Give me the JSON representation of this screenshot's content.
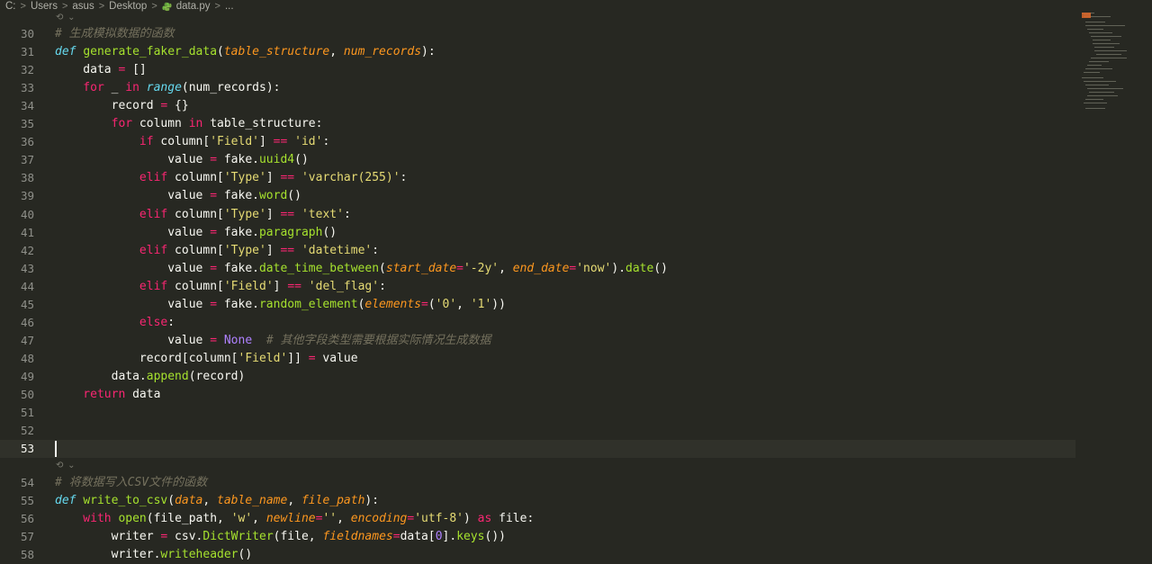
{
  "breadcrumb": {
    "items": [
      "C:",
      "Users",
      "asus",
      "Desktop",
      "data.py",
      "..."
    ],
    "separator": ">"
  },
  "fold_hint": "⟲ ⌄",
  "colors": {
    "background": "#272822",
    "keyword": "#f92672",
    "function": "#a6e22e",
    "string": "#e6db74",
    "parameter": "#fd971f",
    "comment": "#75715e",
    "builtin_def": "#66d9ef"
  },
  "editor": {
    "current_line": 53,
    "lines": [
      {
        "n": "30",
        "segs": [
          [
            "cm",
            "# 生成模拟数据的函数"
          ]
        ]
      },
      {
        "n": "31",
        "segs": [
          [
            "def",
            "def "
          ],
          [
            "fn",
            "generate_faker_data"
          ],
          [
            "pun",
            "("
          ],
          [
            "param",
            "table_structure"
          ],
          [
            "pun",
            ", "
          ],
          [
            "param",
            "num_records"
          ],
          [
            "pun",
            "):"
          ]
        ]
      },
      {
        "n": "32",
        "segs": [
          [
            "pun",
            "    data "
          ],
          [
            "op",
            "="
          ],
          [
            "pun",
            " []"
          ]
        ]
      },
      {
        "n": "33",
        "segs": [
          [
            "kw",
            "    for"
          ],
          [
            "pun",
            " _ "
          ],
          [
            "kw",
            "in"
          ],
          [
            "pun",
            " "
          ],
          [
            "def",
            "range"
          ],
          [
            "pun",
            "(num_records):"
          ]
        ]
      },
      {
        "n": "34",
        "segs": [
          [
            "pun",
            "        record "
          ],
          [
            "op",
            "="
          ],
          [
            "pun",
            " {}"
          ]
        ]
      },
      {
        "n": "35",
        "segs": [
          [
            "kw",
            "        for"
          ],
          [
            "pun",
            " column "
          ],
          [
            "kw",
            "in"
          ],
          [
            "pun",
            " table_structure:"
          ]
        ]
      },
      {
        "n": "36",
        "segs": [
          [
            "kw",
            "            if"
          ],
          [
            "pun",
            " column["
          ],
          [
            "str",
            "'Field'"
          ],
          [
            "pun",
            "] "
          ],
          [
            "op",
            "=="
          ],
          [
            "pun",
            " "
          ],
          [
            "str",
            "'id'"
          ],
          [
            "pun",
            ":"
          ]
        ]
      },
      {
        "n": "37",
        "segs": [
          [
            "pun",
            "                value "
          ],
          [
            "op",
            "="
          ],
          [
            "pun",
            " fake."
          ],
          [
            "fn",
            "uuid4"
          ],
          [
            "pun",
            "()"
          ]
        ]
      },
      {
        "n": "38",
        "segs": [
          [
            "kw",
            "            elif"
          ],
          [
            "pun",
            " column["
          ],
          [
            "str",
            "'Type'"
          ],
          [
            "pun",
            "] "
          ],
          [
            "op",
            "=="
          ],
          [
            "pun",
            " "
          ],
          [
            "str",
            "'varchar(255)'"
          ],
          [
            "pun",
            ":"
          ]
        ]
      },
      {
        "n": "39",
        "segs": [
          [
            "pun",
            "                value "
          ],
          [
            "op",
            "="
          ],
          [
            "pun",
            " fake."
          ],
          [
            "fn",
            "word"
          ],
          [
            "pun",
            "()"
          ]
        ]
      },
      {
        "n": "40",
        "segs": [
          [
            "kw",
            "            elif"
          ],
          [
            "pun",
            " column["
          ],
          [
            "str",
            "'Type'"
          ],
          [
            "pun",
            "] "
          ],
          [
            "op",
            "=="
          ],
          [
            "pun",
            " "
          ],
          [
            "str",
            "'text'"
          ],
          [
            "pun",
            ":"
          ]
        ]
      },
      {
        "n": "41",
        "segs": [
          [
            "pun",
            "                value "
          ],
          [
            "op",
            "="
          ],
          [
            "pun",
            " fake."
          ],
          [
            "fn",
            "paragraph"
          ],
          [
            "pun",
            "()"
          ]
        ]
      },
      {
        "n": "42",
        "segs": [
          [
            "kw",
            "            elif"
          ],
          [
            "pun",
            " column["
          ],
          [
            "str",
            "'Type'"
          ],
          [
            "pun",
            "] "
          ],
          [
            "op",
            "=="
          ],
          [
            "pun",
            " "
          ],
          [
            "str",
            "'datetime'"
          ],
          [
            "pun",
            ":"
          ]
        ]
      },
      {
        "n": "43",
        "segs": [
          [
            "pun",
            "                value "
          ],
          [
            "op",
            "="
          ],
          [
            "pun",
            " fake."
          ],
          [
            "fn",
            "date_time_between"
          ],
          [
            "pun",
            "("
          ],
          [
            "param",
            "start_date"
          ],
          [
            "op",
            "="
          ],
          [
            "str",
            "'-2y'"
          ],
          [
            "pun",
            ", "
          ],
          [
            "param",
            "end_date"
          ],
          [
            "op",
            "="
          ],
          [
            "str",
            "'now'"
          ],
          [
            "pun",
            ")."
          ],
          [
            "fn",
            "date"
          ],
          [
            "pun",
            "()"
          ]
        ]
      },
      {
        "n": "44",
        "segs": [
          [
            "kw",
            "            elif"
          ],
          [
            "pun",
            " column["
          ],
          [
            "str",
            "'Field'"
          ],
          [
            "pun",
            "] "
          ],
          [
            "op",
            "=="
          ],
          [
            "pun",
            " "
          ],
          [
            "str",
            "'del_flag'"
          ],
          [
            "pun",
            ":"
          ]
        ]
      },
      {
        "n": "45",
        "segs": [
          [
            "pun",
            "                value "
          ],
          [
            "op",
            "="
          ],
          [
            "pun",
            " fake."
          ],
          [
            "fn",
            "random_element"
          ],
          [
            "pun",
            "("
          ],
          [
            "param",
            "elements"
          ],
          [
            "op",
            "="
          ],
          [
            "pun",
            "("
          ],
          [
            "str",
            "'0'"
          ],
          [
            "pun",
            ", "
          ],
          [
            "str",
            "'1'"
          ],
          [
            "pun",
            "))"
          ]
        ]
      },
      {
        "n": "46",
        "segs": [
          [
            "kw",
            "            else"
          ],
          [
            "pun",
            ":"
          ]
        ]
      },
      {
        "n": "47",
        "segs": [
          [
            "pun",
            "                value "
          ],
          [
            "op",
            "="
          ],
          [
            "pun",
            " "
          ],
          [
            "num",
            "None"
          ],
          [
            "pun",
            "  "
          ],
          [
            "cm",
            "# 其他字段类型需要根据实际情况生成数据"
          ]
        ]
      },
      {
        "n": "48",
        "segs": [
          [
            "pun",
            "            record[column["
          ],
          [
            "str",
            "'Field'"
          ],
          [
            "pun",
            "]] "
          ],
          [
            "op",
            "="
          ],
          [
            "pun",
            " value"
          ]
        ]
      },
      {
        "n": "49",
        "segs": [
          [
            "pun",
            "        data."
          ],
          [
            "fn",
            "append"
          ],
          [
            "pun",
            "(record)"
          ]
        ]
      },
      {
        "n": "50",
        "segs": [
          [
            "kw",
            "    return"
          ],
          [
            "pun",
            " data"
          ]
        ]
      },
      {
        "n": "51",
        "segs": []
      },
      {
        "n": "52",
        "segs": []
      },
      {
        "n": "53",
        "segs": []
      },
      {
        "n": "54",
        "segs": [
          [
            "cm",
            "# 将数据写入CSV文件的函数"
          ]
        ]
      },
      {
        "n": "55",
        "segs": [
          [
            "def",
            "def "
          ],
          [
            "fn",
            "write_to_csv"
          ],
          [
            "pun",
            "("
          ],
          [
            "param",
            "data"
          ],
          [
            "pun",
            ", "
          ],
          [
            "param",
            "table_name"
          ],
          [
            "pun",
            ", "
          ],
          [
            "param",
            "file_path"
          ],
          [
            "pun",
            "):"
          ]
        ]
      },
      {
        "n": "56",
        "segs": [
          [
            "kw",
            "    with"
          ],
          [
            "pun",
            " "
          ],
          [
            "fn",
            "open"
          ],
          [
            "pun",
            "(file_path, "
          ],
          [
            "str",
            "'w'"
          ],
          [
            "pun",
            ", "
          ],
          [
            "param",
            "newline"
          ],
          [
            "op",
            "="
          ],
          [
            "str",
            "''"
          ],
          [
            "pun",
            ", "
          ],
          [
            "param",
            "encoding"
          ],
          [
            "op",
            "="
          ],
          [
            "str",
            "'utf-8'"
          ],
          [
            "pun",
            ") "
          ],
          [
            "kw",
            "as"
          ],
          [
            "pun",
            " file:"
          ]
        ]
      },
      {
        "n": "57",
        "segs": [
          [
            "pun",
            "        writer "
          ],
          [
            "op",
            "="
          ],
          [
            "pun",
            " csv."
          ],
          [
            "fn",
            "DictWriter"
          ],
          [
            "pun",
            "(file, "
          ],
          [
            "param",
            "fieldnames"
          ],
          [
            "op",
            "="
          ],
          [
            "pun",
            "data["
          ],
          [
            "num",
            "0"
          ],
          [
            "pun",
            "]."
          ],
          [
            "fn",
            "keys"
          ],
          [
            "pun",
            "())"
          ]
        ]
      },
      {
        "n": "58",
        "segs": [
          [
            "pun",
            "        writer."
          ],
          [
            "fn",
            "writeheader"
          ],
          [
            "pun",
            "()"
          ]
        ]
      }
    ]
  }
}
